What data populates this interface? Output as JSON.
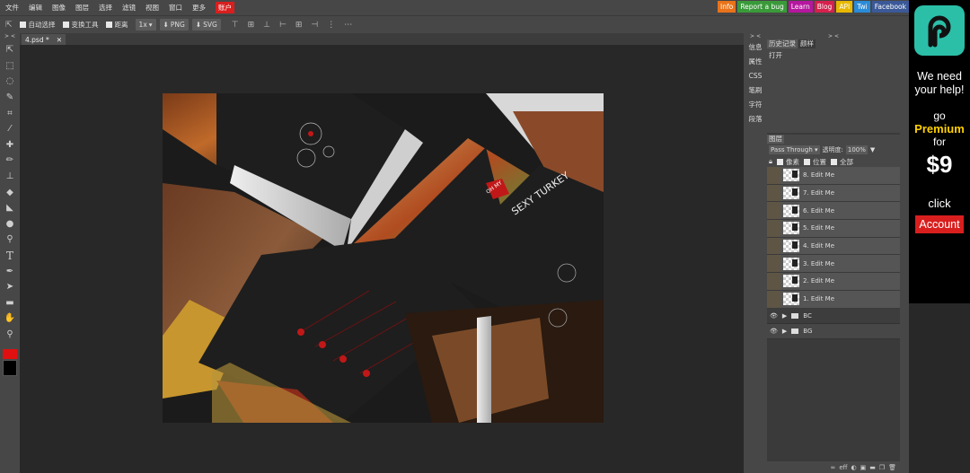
{
  "menu": [
    "文件",
    "编辑",
    "图像",
    "图层",
    "选择",
    "滤镜",
    "视图",
    "窗口",
    "更多"
  ],
  "menu_account": "账户",
  "badges": [
    {
      "label": "Info",
      "color": "#e8731a"
    },
    {
      "label": "Report a bug",
      "color": "#3a9a3a"
    },
    {
      "label": "Learn",
      "color": "#b5179e"
    },
    {
      "label": "Blog",
      "color": "#d6204d"
    },
    {
      "label": "API",
      "color": "#e8b800"
    },
    {
      "label": "Twi",
      "color": "#2a8bd8"
    },
    {
      "label": "Facebook",
      "color": "#3b5998"
    }
  ],
  "toolbar": {
    "auto_select": "自动选择",
    "transform": "变换工具",
    "distance": "距离",
    "zoom": "1x",
    "png": "PNG",
    "svg": "SVG"
  },
  "left_header": "> <",
  "doc_tab": {
    "name": "4.psd *",
    "close": "✕"
  },
  "side_tabs": [
    "信息",
    "属性",
    "CSS",
    "笔刷",
    "字符",
    "段落"
  ],
  "panel": {
    "history_tab": "历史记录",
    "swatches_tab": "颜样",
    "history_items": [
      "打开"
    ],
    "layers_tab": "图层",
    "blend_mode": "Pass Through",
    "opacity_label": "透明度:",
    "opacity_value": "100%",
    "lock_pixels": "像素",
    "lock_position": "位置",
    "lock_all": "全部",
    "layers": [
      "8. Edit Me",
      "7. Edit Me",
      "6. Edit Me",
      "5. Edit Me",
      "4. Edit Me",
      "3. Edit Me",
      "2. Edit Me",
      "1. Edit Me"
    ],
    "groups": [
      "BC",
      "BG"
    ],
    "footer_eff": "eff"
  },
  "canvas_text": {
    "oh_my": "OH MY",
    "sexy_turkey": "SEXY TURKEY"
  },
  "ad": {
    "line1": "We need your help!",
    "line2": "go",
    "premium": "Premium",
    "line3": "for",
    "price": "$9",
    "line4": "click",
    "button": "Account"
  },
  "colors": {
    "fg": "#e01010",
    "bg": "#000000",
    "accent": "#d91e1e",
    "ad_logo": "#2bbfa8"
  }
}
